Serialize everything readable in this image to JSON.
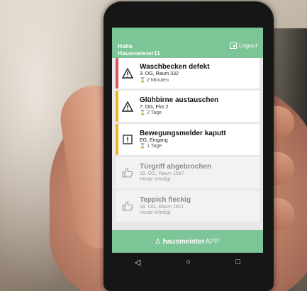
{
  "header": {
    "greeting_line1": "Hallo",
    "greeting_line2": "Hausmeister11",
    "logout_label": "Logout",
    "color": "#7cc596"
  },
  "tasks": [
    {
      "title": "Waschbecken defekt",
      "location": "3. OG, Raum 332",
      "time": "2 Minuten",
      "status_color": "#e0525a",
      "icon": "warning-triangle-icon",
      "done": false
    },
    {
      "title": "Glühbirne austauschen",
      "location": "7. OG, Flur 2",
      "time": "2 Tage",
      "status_color": "#f0b429",
      "icon": "warning-triangle-icon",
      "done": false
    },
    {
      "title": "Bewegungsmelder kaputt",
      "location": "EG, Eingang",
      "time": "1 Tage",
      "status_color": "#f0b429",
      "icon": "exclamation-box-icon",
      "done": false
    },
    {
      "title": "Türgriff abgebrochen",
      "location": "15. OG, Raum 1567",
      "time": "Heute erledigt",
      "icon": "thumbs-up-icon",
      "done": true
    },
    {
      "title": "Teppich fleckig",
      "location": "18. OG, Raum 1811",
      "time": "Heute erledigt",
      "icon": "thumbs-up-icon",
      "done": true
    }
  ],
  "footer": {
    "brand_bold": "hausmeister",
    "brand_suffix": "APP",
    "logo_glyph": "∆"
  },
  "navbar": {
    "back": "◁",
    "home": "○",
    "recents": "□"
  }
}
